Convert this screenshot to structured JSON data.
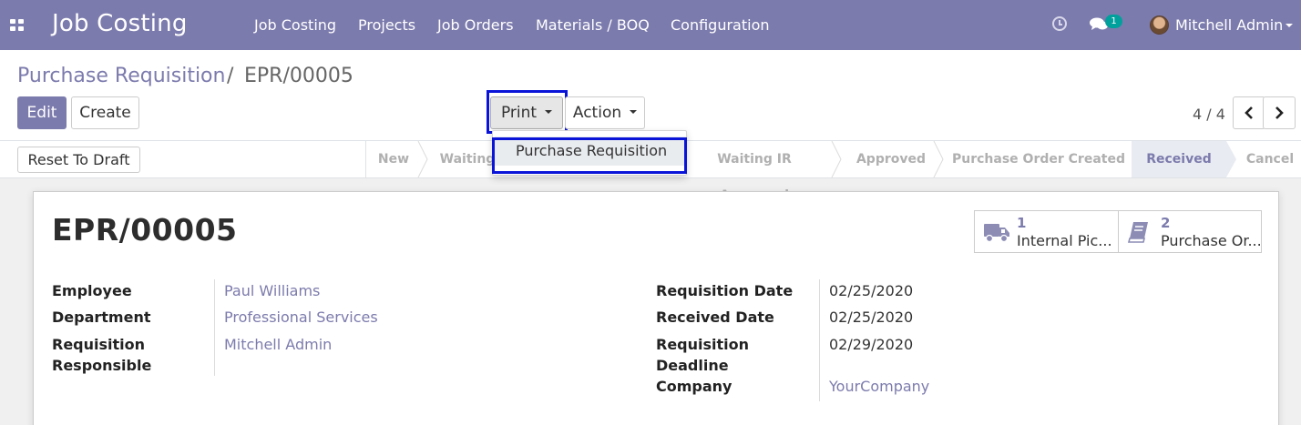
{
  "navbar": {
    "app_title": "Job Costing",
    "menu": [
      "Job Costing",
      "Projects",
      "Job Orders",
      "Materials / BOQ",
      "Configuration"
    ],
    "chat_badge": "1",
    "user_name": "Mitchell Admin",
    "bg_color": "#7c7bad"
  },
  "breadcrumb": {
    "parent": "Purchase Requisition",
    "separator": "/",
    "current": "EPR/00005"
  },
  "buttons": {
    "edit": "Edit",
    "create": "Create",
    "print": "Print",
    "action": "Action",
    "reset_to_draft": "Reset To Draft"
  },
  "pager": {
    "value": "4 / 4"
  },
  "print_dropdown": {
    "items": [
      "Purchase Requisition"
    ]
  },
  "stages": [
    "New",
    "Waiting",
    "Waiting IR Approved",
    "Approved",
    "Purchase Order Created",
    "Received",
    "Cancel"
  ],
  "active_stage": "Received",
  "record": {
    "title": "EPR/00005",
    "smart_buttons": [
      {
        "value": "1",
        "label": "Internal Pic...",
        "icon": "truck-icon"
      },
      {
        "value": "2",
        "label": "Purchase Or...",
        "icon": "book-icon"
      }
    ],
    "left_fields": [
      {
        "label": "Employee",
        "value": "Paul Williams"
      },
      {
        "label": "Department",
        "value": "Professional Services"
      },
      {
        "label": "Requisition Responsible",
        "value": "Mitchell Admin"
      }
    ],
    "right_fields": [
      {
        "label": "Requisition Date",
        "value": "02/25/2020"
      },
      {
        "label": "Received Date",
        "value": "02/25/2020"
      },
      {
        "label": "Requisition Deadline",
        "value": "02/29/2020"
      },
      {
        "label": "Company",
        "value": "YourCompany"
      }
    ]
  },
  "highlight_color": "#0a14d8"
}
